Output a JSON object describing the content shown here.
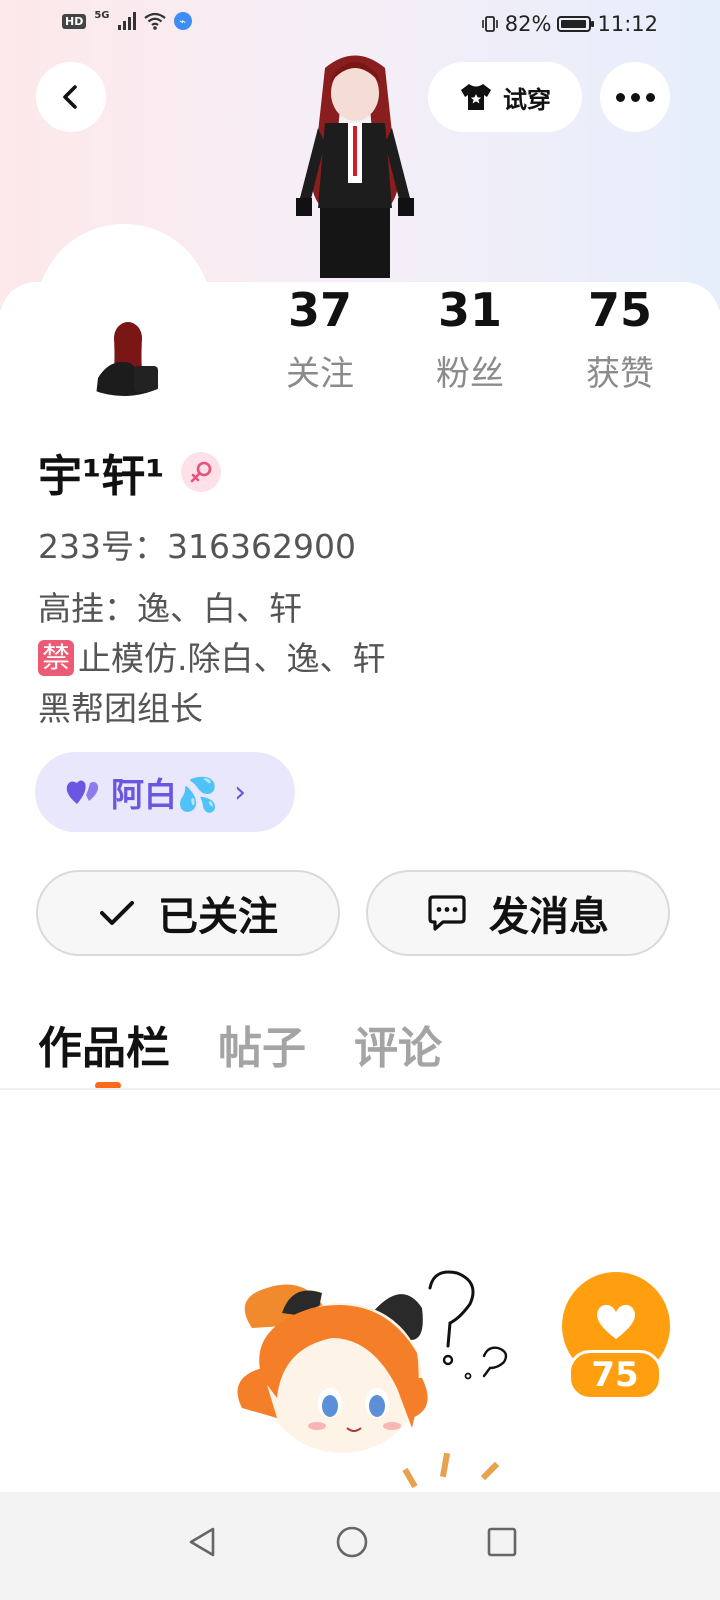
{
  "status_bar": {
    "hd": "HD",
    "network": "5G",
    "battery_percent": "82%",
    "time": "11:12",
    "battery_level": 0.82
  },
  "top_bar": {
    "back_icon": "chevron-left-icon",
    "tryon_label": "试穿",
    "tryon_icon": "tshirt-icon",
    "more_icon": "more-dots-icon"
  },
  "profile": {
    "stats": [
      {
        "value": "37",
        "label": "关注"
      },
      {
        "value": "31",
        "label": "粉丝"
      },
      {
        "value": "75",
        "label": "获赞"
      }
    ],
    "username": "宇¹轩¹",
    "gender_icon": "female-icon",
    "uid_line": "233号：316362900",
    "bio_lines": [
      "高挂：逸、白、轩",
      "止模仿.除白、逸、轩",
      "黑帮团组长"
    ],
    "ban_badge": "禁",
    "couple": {
      "name": "阿白💦",
      "icon": "heart-icon"
    }
  },
  "actions": {
    "follow_label": "已关注",
    "message_label": "发消息"
  },
  "tabs": [
    "作品栏",
    "帖子",
    "评论"
  ],
  "like_fab": {
    "count": "75",
    "icon": "heart-icon"
  },
  "nav": {
    "back": "back-triangle-icon",
    "home": "home-circle-icon",
    "recents": "recents-square-icon"
  },
  "colors": {
    "accent": "#ff6a1a",
    "like_orange": "#ff9f10",
    "couple_purple": "#6a56e0"
  }
}
